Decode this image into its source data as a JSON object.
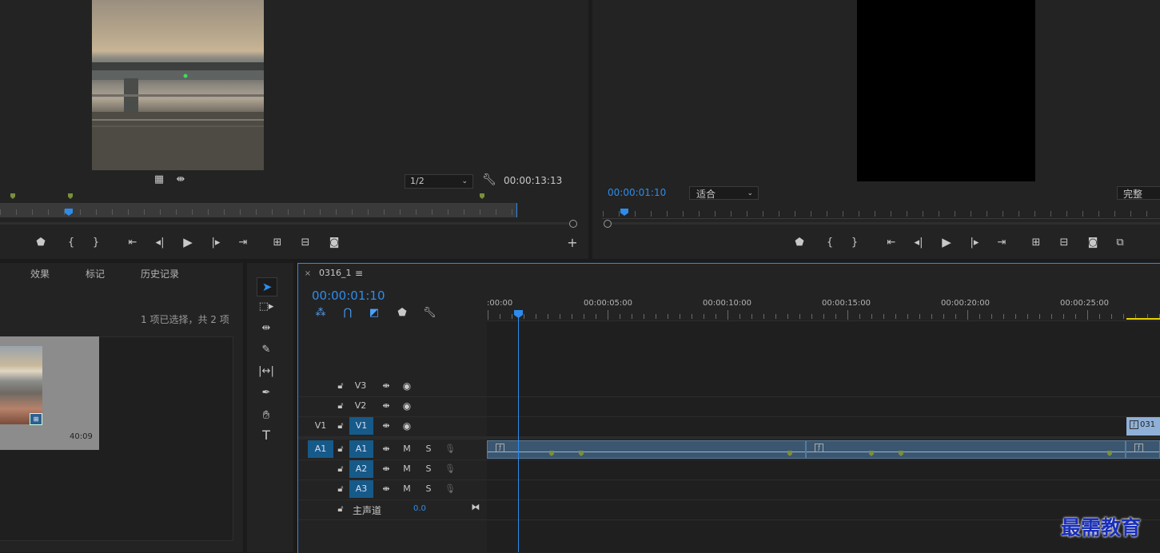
{
  "source_monitor": {
    "timecode": "00:00:13:13",
    "zoom": "1/2"
  },
  "program_monitor": {
    "timecode": "00:00:01:10",
    "fit": "适合",
    "quality": "完整"
  },
  "project_panel": {
    "tabs": [
      "效果",
      "标记",
      "历史记录"
    ],
    "selection_info": "1 项已选择，共 2 项",
    "clip_duration": "40:09"
  },
  "timeline": {
    "sequence_name": "0316_1",
    "timecode": "00:00:01:10",
    "ruler_labels": [
      ":00:00",
      "00:00:05:00",
      "00:00:10:00",
      "00:00:15:00",
      "00:00:20:00",
      "00:00:25:00"
    ],
    "tracks": {
      "video": [
        {
          "source": "",
          "name": "V3"
        },
        {
          "source": "",
          "name": "V2"
        },
        {
          "source": "V1",
          "name": "V1"
        }
      ],
      "audio": [
        {
          "source": "A1",
          "name": "A1"
        },
        {
          "source": "",
          "name": "A2"
        },
        {
          "source": "",
          "name": "A3"
        }
      ],
      "mute_label": "M",
      "solo_label": "S",
      "master_label": "主声道",
      "master_value": "0.0"
    },
    "clip_label_partial": "031"
  },
  "watermark": "最需教育",
  "colors": {
    "accent_blue": "#2d8ceb",
    "track_selected": "#165a8a",
    "audio_clip": "#3b5670",
    "marker_green": "#7a8f3a"
  }
}
